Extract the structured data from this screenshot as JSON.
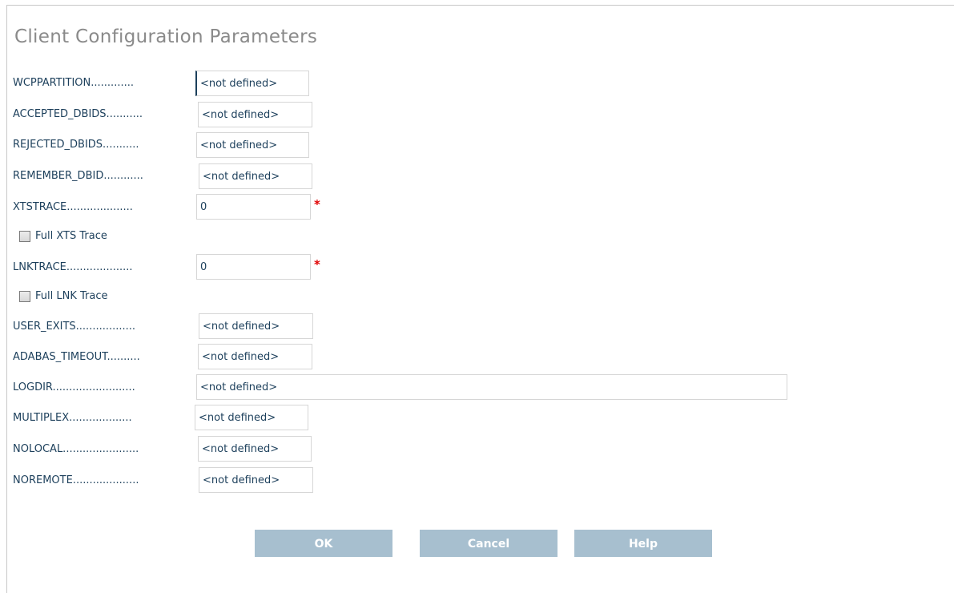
{
  "title": "Client Configuration Parameters",
  "params": [
    {
      "label": "WCPPARTITION.............",
      "value": "<not defined>",
      "required": false
    },
    {
      "label": "ACCEPTED_DBIDS...........",
      "value": "<not defined>",
      "required": false
    },
    {
      "label": "REJECTED_DBIDS...........",
      "value": "<not defined>",
      "required": false
    },
    {
      "label": "REMEMBER_DBID............",
      "value": "<not defined>",
      "required": false
    },
    {
      "label": "XTSTRACE....................",
      "value": "0",
      "required": true
    },
    {
      "label": "LNKTRACE....................",
      "value": "0",
      "required": true
    },
    {
      "label": "USER_EXITS..................",
      "value": "<not defined>",
      "required": false
    },
    {
      "label": "ADABAS_TIMEOUT..........",
      "value": "<not defined>",
      "required": false
    },
    {
      "label": "LOGDIR.........................",
      "value": "<not defined>",
      "required": false
    },
    {
      "label": "MULTIPLEX...................",
      "value": "<not defined>",
      "required": false
    },
    {
      "label": "NOLOCAL.......................",
      "value": "<not defined>",
      "required": false
    },
    {
      "label": "NOREMOTE....................",
      "value": "<not defined>",
      "required": false
    }
  ],
  "checkboxes": [
    {
      "label": "Full XTS Trace",
      "checked": false
    },
    {
      "label": "Full LNK Trace",
      "checked": false
    }
  ],
  "required_marker": "*",
  "buttons": {
    "ok": "OK",
    "cancel": "Cancel",
    "help": "Help"
  },
  "colors": {
    "button_bg": "#a7bfcf",
    "required": "#e00000",
    "text": "#1c3f5b"
  }
}
